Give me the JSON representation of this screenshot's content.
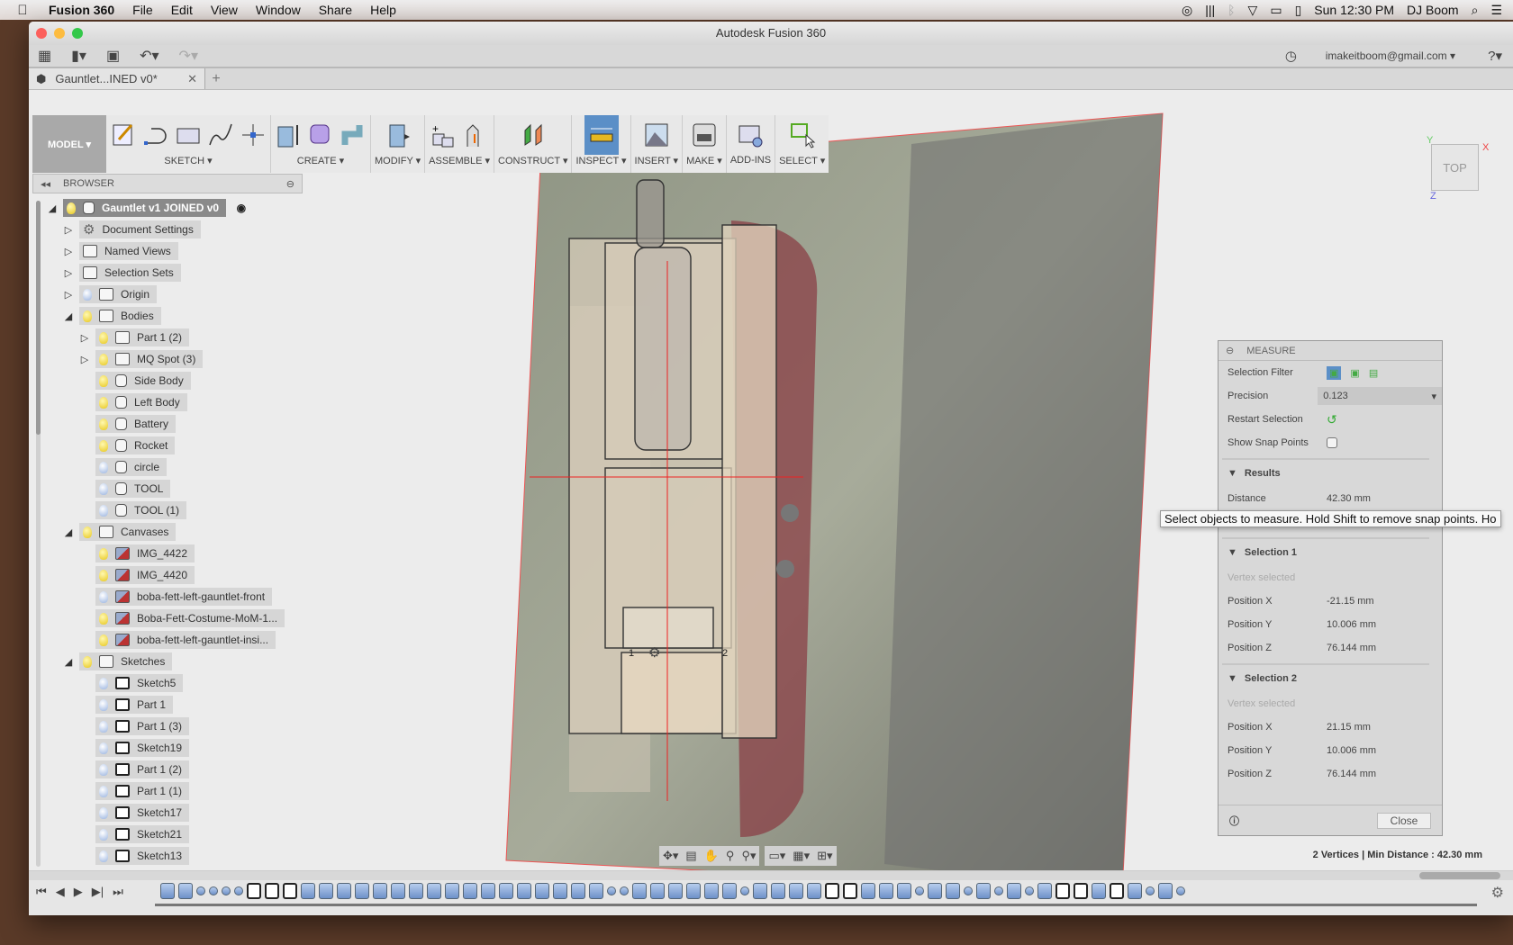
{
  "menubar": {
    "app": "Fusion 360",
    "items": [
      "File",
      "Edit",
      "View",
      "Window",
      "Share",
      "Help"
    ],
    "clock": "Sun 12:30 PM",
    "user": "DJ Boom"
  },
  "window": {
    "title": "Autodesk Fusion 360",
    "account": "imakeitboom@gmail.com ▾",
    "tab": "Gauntlet...INED v0*"
  },
  "ribbon": {
    "mode": "MODEL ▾",
    "groups": [
      "SKETCH ▾",
      "CREATE ▾",
      "MODIFY ▾",
      "ASSEMBLE ▾",
      "CONSTRUCT ▾",
      "INSPECT ▾",
      "INSERT ▾",
      "MAKE ▾",
      "ADD-INS",
      "SELECT ▾"
    ],
    "active_group": "INSPECT ▾"
  },
  "browser": {
    "title": "BROWSER",
    "items": [
      {
        "label": "Gauntlet v1 JOINED v0",
        "level": 0,
        "tw": "open",
        "bulb": "on",
        "icon": "body",
        "root": true
      },
      {
        "label": "Document Settings",
        "level": 1,
        "tw": "closed",
        "icon": "gear"
      },
      {
        "label": "Named Views",
        "level": 1,
        "tw": "closed",
        "icon": "folder"
      },
      {
        "label": "Selection Sets",
        "level": 1,
        "tw": "closed",
        "icon": "folder"
      },
      {
        "label": "Origin",
        "level": 1,
        "tw": "closed",
        "bulb": "off",
        "icon": "folder"
      },
      {
        "label": "Bodies",
        "level": 1,
        "tw": "open",
        "bulb": "on",
        "icon": "folder"
      },
      {
        "label": "Part 1 (2)",
        "level": 2,
        "tw": "closed",
        "bulb": "on",
        "icon": "folder"
      },
      {
        "label": "MQ Spot (3)",
        "level": 2,
        "tw": "closed",
        "bulb": "on",
        "icon": "folder"
      },
      {
        "label": "Side Body",
        "level": 2,
        "bulb": "on",
        "icon": "body"
      },
      {
        "label": "Left Body",
        "level": 2,
        "bulb": "on",
        "icon": "body"
      },
      {
        "label": "Battery",
        "level": 2,
        "bulb": "on",
        "icon": "body"
      },
      {
        "label": "Rocket",
        "level": 2,
        "bulb": "on",
        "icon": "body"
      },
      {
        "label": "circle",
        "level": 2,
        "bulb": "off",
        "icon": "body"
      },
      {
        "label": "TOOL",
        "level": 2,
        "bulb": "off",
        "icon": "body"
      },
      {
        "label": "TOOL (1)",
        "level": 2,
        "bulb": "off",
        "icon": "body"
      },
      {
        "label": "Canvases",
        "level": 1,
        "tw": "open",
        "bulb": "on",
        "icon": "folder"
      },
      {
        "label": "IMG_4422",
        "level": 2,
        "bulb": "on",
        "icon": "canvas"
      },
      {
        "label": "IMG_4420",
        "level": 2,
        "bulb": "on",
        "icon": "canvas"
      },
      {
        "label": "boba-fett-left-gauntlet-front",
        "level": 2,
        "bulb": "off",
        "icon": "canvas"
      },
      {
        "label": "Boba-Fett-Costume-MoM-1...",
        "level": 2,
        "bulb": "on",
        "icon": "canvas"
      },
      {
        "label": "boba-fett-left-gauntlet-insi...",
        "level": 2,
        "bulb": "on",
        "icon": "canvas"
      },
      {
        "label": "Sketches",
        "level": 1,
        "tw": "open",
        "bulb": "on",
        "icon": "folder"
      },
      {
        "label": "Sketch5",
        "level": 2,
        "bulb": "off",
        "icon": "sketch"
      },
      {
        "label": "Part 1",
        "level": 2,
        "bulb": "off",
        "icon": "sketch"
      },
      {
        "label": "Part 1 (3)",
        "level": 2,
        "bulb": "off",
        "icon": "sketch"
      },
      {
        "label": "Sketch19",
        "level": 2,
        "bulb": "off",
        "icon": "sketch"
      },
      {
        "label": "Part 1 (2)",
        "level": 2,
        "bulb": "off",
        "icon": "sketch"
      },
      {
        "label": "Part 1 (1)",
        "level": 2,
        "bulb": "off",
        "icon": "sketch"
      },
      {
        "label": "Sketch17",
        "level": 2,
        "bulb": "off",
        "icon": "sketch"
      },
      {
        "label": "Sketch21",
        "level": 2,
        "bulb": "off",
        "icon": "sketch"
      },
      {
        "label": "Sketch13",
        "level": 2,
        "bulb": "off",
        "icon": "sketch"
      }
    ]
  },
  "measure": {
    "title": "MEASURE",
    "selection_filter": "Selection Filter",
    "precision_label": "Precision",
    "precision": "0.123",
    "restart": "Restart Selection",
    "snap": "Show Snap Points",
    "snap_checked": false,
    "results": "Results",
    "distance_label": "Distance",
    "distance": "42.30 mm",
    "sel1": {
      "title": "Selection 1",
      "status": "Vertex selected",
      "x_label": "Position X",
      "x": "-21.15 mm",
      "y_label": "Position Y",
      "y": "10.006 mm",
      "z_label": "Position Z",
      "z": "76.144 mm"
    },
    "sel2": {
      "title": "Selection 2",
      "status": "Vertex selected",
      "x_label": "Position X",
      "x": "21.15 mm",
      "y_label": "Position Y",
      "y": "10.006 mm",
      "z_label": "Position Z",
      "z": "76.144 mm"
    },
    "close": "Close"
  },
  "tooltip": "Select objects to measure. Hold Shift to remove snap points. Ho",
  "viewport": {
    "viewcube": "TOP",
    "axis_x": "X",
    "axis_y": "Y",
    "axis_z": "Z",
    "point1": "1",
    "point2": "2"
  },
  "status": "2 Vertices | Min Distance : 42.30 mm",
  "timeline": {
    "features": "eeoooo sss eeeeeeeeeeeeeeeeeooeeeeeeoeee esseeeoeeo eoeoesseseoeo"
  }
}
